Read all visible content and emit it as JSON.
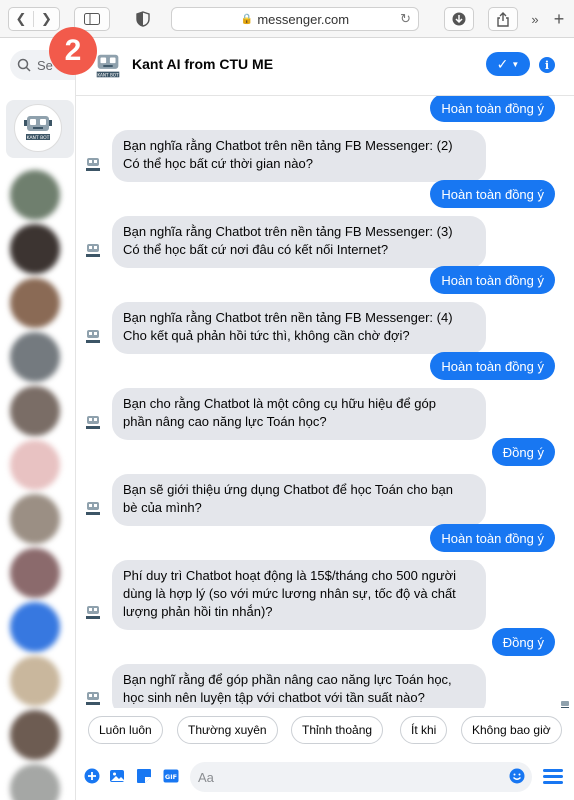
{
  "browser": {
    "url": "messenger.com"
  },
  "sidebar": {
    "search_placeholder": "Se",
    "badge_number": "2"
  },
  "header": {
    "title": "Kant AI from CTU ME"
  },
  "bot_avatar_text": "KANT BOT",
  "messages": [
    {
      "from": "user",
      "text": "Hoàn toàn đồng ý"
    },
    {
      "from": "bot",
      "line1": "Bạn nghĩa rằng Chatbot trên nền tảng FB Messenger: (2)",
      "line2": "Có thể học bất cứ thời gian nào?"
    },
    {
      "from": "user",
      "text": "Hoàn toàn đồng ý"
    },
    {
      "from": "bot",
      "line1": "Bạn nghĩa rằng Chatbot trên nền tảng FB Messenger: (3)",
      "line2": "Có thể học bất cứ nơi đâu có kết nối Internet?"
    },
    {
      "from": "user",
      "text": "Hoàn toàn đồng ý"
    },
    {
      "from": "bot",
      "line1": "Bạn nghĩa rằng Chatbot trên nền tảng FB Messenger: (4)",
      "line2": "Cho kết quả phản hồi tức thì, không cần chờ đợi?"
    },
    {
      "from": "user",
      "text": "Hoàn toàn đồng ý"
    },
    {
      "from": "bot",
      "line1": "Bạn cho rằng Chatbot là một công cụ hữu hiệu để góp",
      "line2": "phần nâng cao năng lực Toán học?"
    },
    {
      "from": "user",
      "text": "Đồng ý"
    },
    {
      "from": "bot",
      "line1": "Bạn sẽ giới thiệu ứng dụng Chatbot để học Toán cho bạn",
      "line2": "bè của mình?"
    },
    {
      "from": "user",
      "text": "Hoàn toàn đồng ý"
    },
    {
      "from": "bot",
      "line1": "Phí duy trì Chatbot hoạt động là 15$/tháng cho 500 người",
      "line2": "dùng là hợp lý (so với mức lương nhân sự, tốc độ và chất",
      "line3": "lượng phản hồi tin nhắn)?"
    },
    {
      "from": "user",
      "text": "Đồng ý"
    },
    {
      "from": "bot",
      "line1": "Bạn nghĩ rằng để góp phần nâng cao năng lực Toán học,",
      "line2": "học sinh nên luyện tập với chatbot với tần suất nào?"
    }
  ],
  "quick_replies": [
    "Luôn luôn",
    "Thường xuyên",
    "Thỉnh thoảng",
    "Ít khi",
    "Không bao giờ"
  ],
  "composer": {
    "placeholder": "Aa"
  },
  "colors": {
    "accent": "#1877f2",
    "incoming_bubble": "#e4e6eb",
    "badge": "#f25a4b"
  }
}
